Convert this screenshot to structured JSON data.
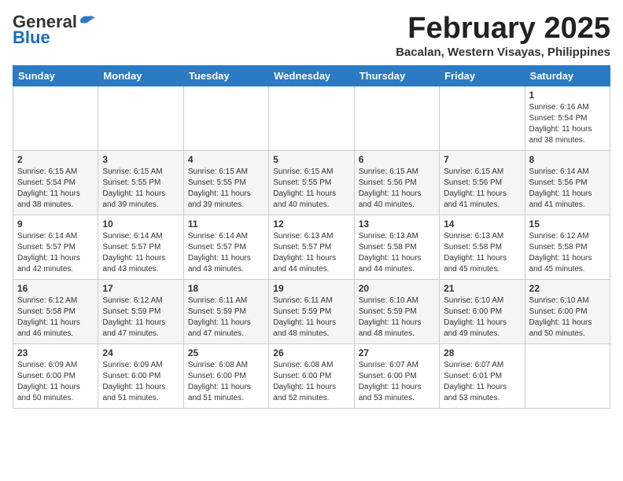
{
  "logo": {
    "general": "General",
    "blue": "Blue"
  },
  "header": {
    "month": "February 2025",
    "location": "Bacalan, Western Visayas, Philippines"
  },
  "weekdays": [
    "Sunday",
    "Monday",
    "Tuesday",
    "Wednesday",
    "Thursday",
    "Friday",
    "Saturday"
  ],
  "weeks": [
    [
      {
        "day": "",
        "info": ""
      },
      {
        "day": "",
        "info": ""
      },
      {
        "day": "",
        "info": ""
      },
      {
        "day": "",
        "info": ""
      },
      {
        "day": "",
        "info": ""
      },
      {
        "day": "",
        "info": ""
      },
      {
        "day": "1",
        "info": "Sunrise: 6:16 AM\nSunset: 5:54 PM\nDaylight: 11 hours\nand 38 minutes."
      }
    ],
    [
      {
        "day": "2",
        "info": "Sunrise: 6:15 AM\nSunset: 5:54 PM\nDaylight: 11 hours\nand 38 minutes."
      },
      {
        "day": "3",
        "info": "Sunrise: 6:15 AM\nSunset: 5:55 PM\nDaylight: 11 hours\nand 39 minutes."
      },
      {
        "day": "4",
        "info": "Sunrise: 6:15 AM\nSunset: 5:55 PM\nDaylight: 11 hours\nand 39 minutes."
      },
      {
        "day": "5",
        "info": "Sunrise: 6:15 AM\nSunset: 5:55 PM\nDaylight: 11 hours\nand 40 minutes."
      },
      {
        "day": "6",
        "info": "Sunrise: 6:15 AM\nSunset: 5:56 PM\nDaylight: 11 hours\nand 40 minutes."
      },
      {
        "day": "7",
        "info": "Sunrise: 6:15 AM\nSunset: 5:56 PM\nDaylight: 11 hours\nand 41 minutes."
      },
      {
        "day": "8",
        "info": "Sunrise: 6:14 AM\nSunset: 5:56 PM\nDaylight: 11 hours\nand 41 minutes."
      }
    ],
    [
      {
        "day": "9",
        "info": "Sunrise: 6:14 AM\nSunset: 5:57 PM\nDaylight: 11 hours\nand 42 minutes."
      },
      {
        "day": "10",
        "info": "Sunrise: 6:14 AM\nSunset: 5:57 PM\nDaylight: 11 hours\nand 43 minutes."
      },
      {
        "day": "11",
        "info": "Sunrise: 6:14 AM\nSunset: 5:57 PM\nDaylight: 11 hours\nand 43 minutes."
      },
      {
        "day": "12",
        "info": "Sunrise: 6:13 AM\nSunset: 5:57 PM\nDaylight: 11 hours\nand 44 minutes."
      },
      {
        "day": "13",
        "info": "Sunrise: 6:13 AM\nSunset: 5:58 PM\nDaylight: 11 hours\nand 44 minutes."
      },
      {
        "day": "14",
        "info": "Sunrise: 6:13 AM\nSunset: 5:58 PM\nDaylight: 11 hours\nand 45 minutes."
      },
      {
        "day": "15",
        "info": "Sunrise: 6:12 AM\nSunset: 5:58 PM\nDaylight: 11 hours\nand 45 minutes."
      }
    ],
    [
      {
        "day": "16",
        "info": "Sunrise: 6:12 AM\nSunset: 5:58 PM\nDaylight: 11 hours\nand 46 minutes."
      },
      {
        "day": "17",
        "info": "Sunrise: 6:12 AM\nSunset: 5:59 PM\nDaylight: 11 hours\nand 47 minutes."
      },
      {
        "day": "18",
        "info": "Sunrise: 6:11 AM\nSunset: 5:59 PM\nDaylight: 11 hours\nand 47 minutes."
      },
      {
        "day": "19",
        "info": "Sunrise: 6:11 AM\nSunset: 5:59 PM\nDaylight: 11 hours\nand 48 minutes."
      },
      {
        "day": "20",
        "info": "Sunrise: 6:10 AM\nSunset: 5:59 PM\nDaylight: 11 hours\nand 48 minutes."
      },
      {
        "day": "21",
        "info": "Sunrise: 6:10 AM\nSunset: 6:00 PM\nDaylight: 11 hours\nand 49 minutes."
      },
      {
        "day": "22",
        "info": "Sunrise: 6:10 AM\nSunset: 6:00 PM\nDaylight: 11 hours\nand 50 minutes."
      }
    ],
    [
      {
        "day": "23",
        "info": "Sunrise: 6:09 AM\nSunset: 6:00 PM\nDaylight: 11 hours\nand 50 minutes."
      },
      {
        "day": "24",
        "info": "Sunrise: 6:09 AM\nSunset: 6:00 PM\nDaylight: 11 hours\nand 51 minutes."
      },
      {
        "day": "25",
        "info": "Sunrise: 6:08 AM\nSunset: 6:00 PM\nDaylight: 11 hours\nand 51 minutes."
      },
      {
        "day": "26",
        "info": "Sunrise: 6:08 AM\nSunset: 6:00 PM\nDaylight: 11 hours\nand 52 minutes."
      },
      {
        "day": "27",
        "info": "Sunrise: 6:07 AM\nSunset: 6:00 PM\nDaylight: 11 hours\nand 53 minutes."
      },
      {
        "day": "28",
        "info": "Sunrise: 6:07 AM\nSunset: 6:01 PM\nDaylight: 11 hours\nand 53 minutes."
      },
      {
        "day": "",
        "info": ""
      }
    ]
  ]
}
